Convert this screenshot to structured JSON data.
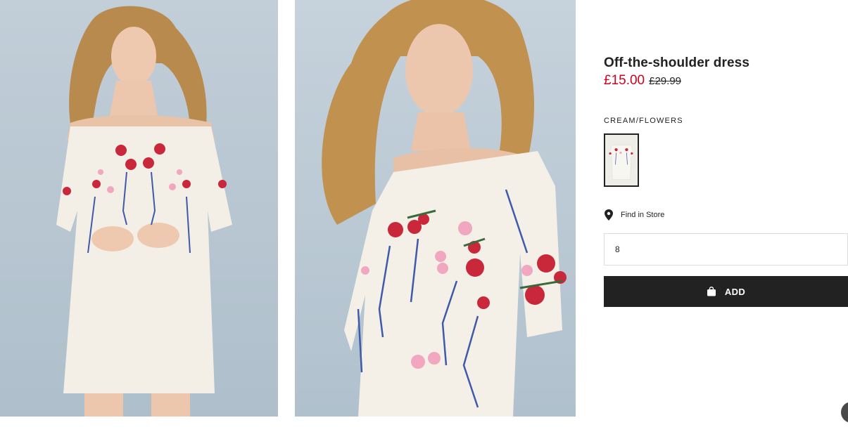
{
  "product": {
    "title": "Off-the-shoulder dress",
    "price_sale": "£15.00",
    "price_original": "£29.99",
    "sale_color": "#d0021b"
  },
  "color": {
    "name": "CREAM/FLOWERS"
  },
  "find_in_store": {
    "label": "Find in Store",
    "icon": "map-pin-icon"
  },
  "size_select": {
    "value": "8"
  },
  "add_button": {
    "label": "ADD",
    "icon": "shopping-bag-icon",
    "background": "#222222"
  },
  "images": [
    {
      "description_icon": "product-photo-front"
    },
    {
      "description_icon": "product-photo-closeup"
    }
  ]
}
